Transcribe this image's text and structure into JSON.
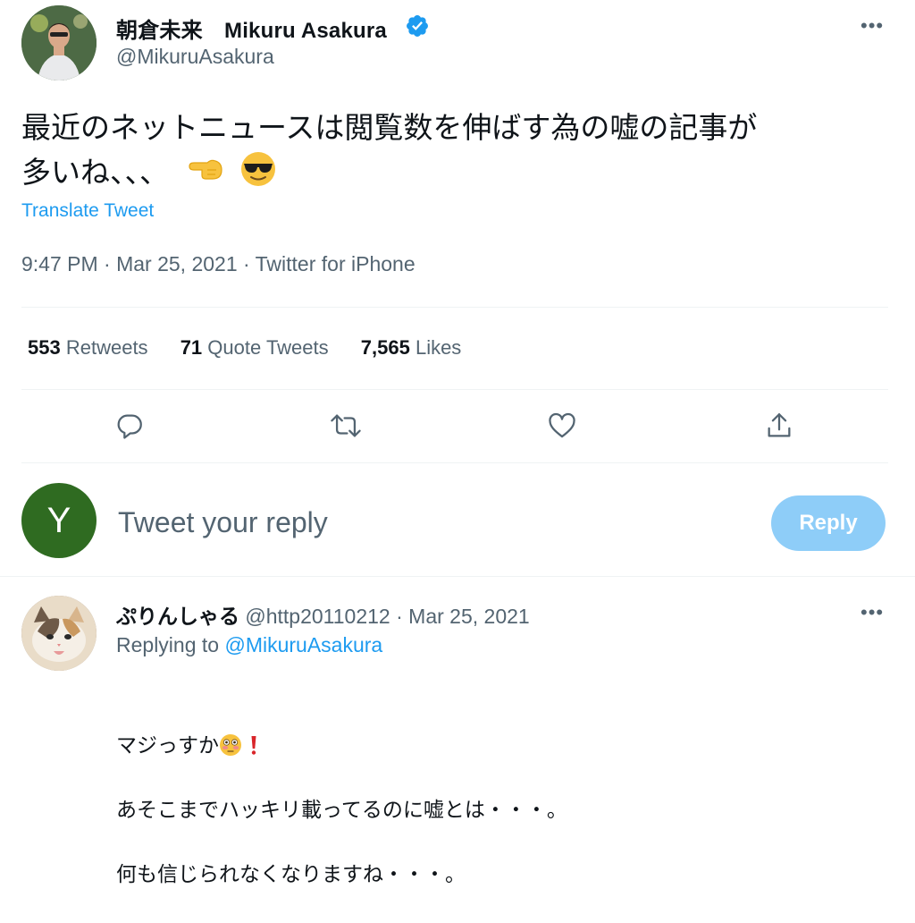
{
  "tweet": {
    "author_name": "朝倉未来　Mikuru Asakura",
    "author_handle": "@MikuruAsakura",
    "verified_icon": "verified-badge-icon",
    "text_line1": "最近のネットニュースは閲覧数を伸ばす為の嘘の記事が",
    "text_line2": "多いね、、、",
    "text_emojis": [
      "pointing-left-hand-emoji",
      "sunglasses-face-emoji"
    ],
    "translate_label": "Translate Tweet",
    "timestamp": "9:47 PM · Mar 25, 2021 · Twitter for iPhone",
    "stats": {
      "retweets_count": "553",
      "retweets_label": "Retweets",
      "quotes_count": "71",
      "quotes_label": "Quote Tweets",
      "likes_count": "7,565",
      "likes_label": "Likes"
    },
    "actions": [
      "reply-icon",
      "retweet-icon",
      "like-icon",
      "share-icon"
    ]
  },
  "compose": {
    "avatar_letter": "Y",
    "placeholder": "Tweet your reply",
    "button_label": "Reply",
    "avatar_color": "#2f6b21",
    "button_color": "#8ecdf8"
  },
  "reply": {
    "name": "ぷりんしゃる",
    "meta": "@http20110212 · Mar 25, 2021",
    "replying_label": "Replying to",
    "replying_to": "@MikuruAsakura",
    "line1": "マジっすか",
    "line1_emojis": [
      "flushed-face-emoji",
      "exclamation-mark-emoji"
    ],
    "line2": "あそこまでハッキリ載ってるのに嘘とは・・・。",
    "line3": "何も信じられなくなりますね・・・。"
  },
  "colors": {
    "accent": "#1d9bf0",
    "secondary_text": "#536471",
    "primary_text": "#0f1419",
    "divider": "#eff3f4"
  }
}
